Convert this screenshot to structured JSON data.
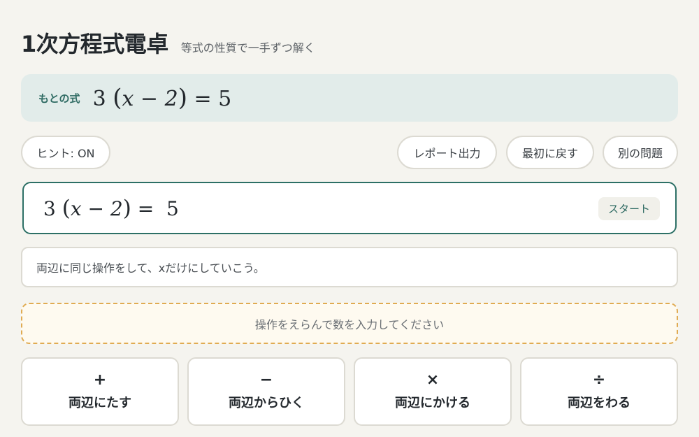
{
  "header": {
    "title": "1次方程式電卓",
    "subtitle": "等式の性質で一手ずつ解く"
  },
  "original": {
    "label": "もとの式",
    "coef": "3",
    "open": "(",
    "inner": "x − 2",
    "close": ")",
    "rhs": "= 5"
  },
  "toolbar": {
    "hint_toggle": "ヒント: ON",
    "report": "レポート出力",
    "reset": "最初に戻す",
    "new_problem": "別の問題"
  },
  "current": {
    "coef": "3",
    "open": "(",
    "inner": "x − 2",
    "close": ")",
    "rhs": " =  5",
    "step_badge": "スタート"
  },
  "hint": {
    "text": "両辺に同じ操作をして、xだけにしていこう。"
  },
  "prompt": {
    "text": "操作をえらんで数を入力してください"
  },
  "operations": [
    {
      "symbol": "+",
      "label": "両辺にたす"
    },
    {
      "symbol": "−",
      "label": "両辺からひく"
    },
    {
      "symbol": "×",
      "label": "両辺にかける"
    },
    {
      "symbol": "÷",
      "label": "両辺をわる"
    }
  ]
}
